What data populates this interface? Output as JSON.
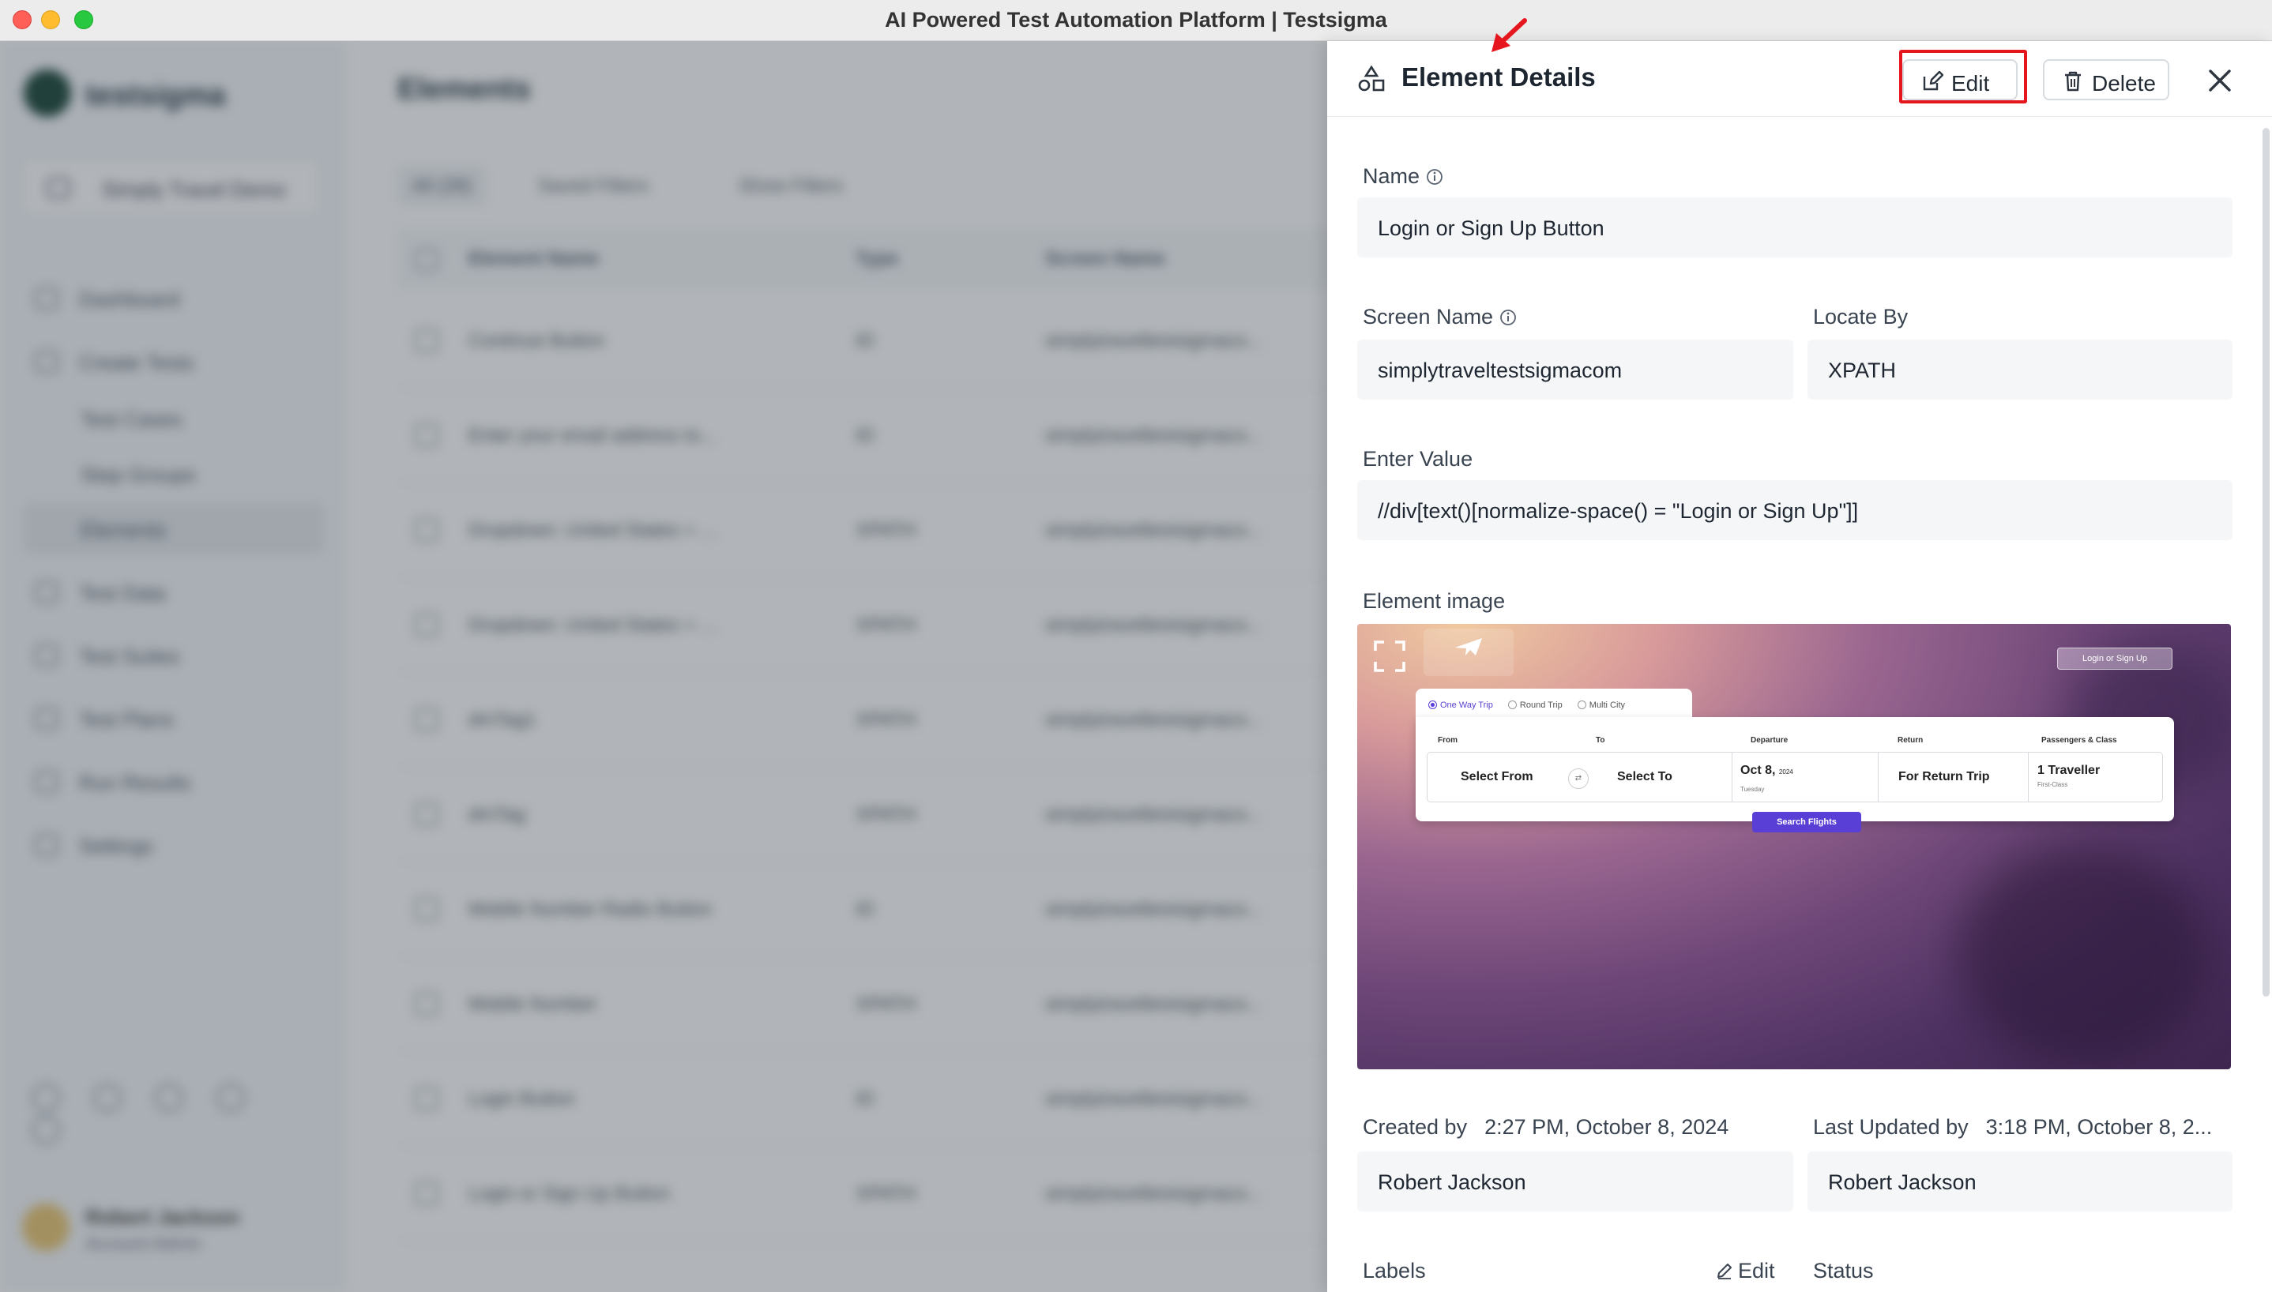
{
  "window": {
    "title": "AI Powered Test Automation Platform | Testsigma"
  },
  "background": {
    "logo": "testsigma",
    "project": "Simply Travel Demo",
    "nav": [
      "Dashboard",
      "Create Tests",
      "Test Cases",
      "Step Groups",
      "Elements",
      "Test Data",
      "Test Suites",
      "Test Plans",
      "Run Results",
      "Settings"
    ],
    "page_title": "Elements",
    "filters": [
      "All (28)",
      "Saved Filters",
      "Show Filters"
    ],
    "columns": [
      "Element Name",
      "Type",
      "Screen Name"
    ],
    "rows": [
      {
        "name": "Continue Button",
        "type": "ID",
        "screen": "simplytraveltestsigmaco..."
      },
      {
        "name": "Enter your email address to...",
        "type": "ID",
        "screen": "simplytraveltestsigmaco..."
      },
      {
        "name": "Dropdown: United States + ...",
        "type": "XPATH",
        "screen": "simplytraveltestsigmaco..."
      },
      {
        "name": "Dropdown: United States + ...",
        "type": "XPATH",
        "screen": "simplytraveltestsigmaco..."
      },
      {
        "name": "dmTag1",
        "type": "XPATH",
        "screen": "simplytraveltestsigmaco..."
      },
      {
        "name": "dmTag",
        "type": "XPATH",
        "screen": "simplytraveltestsigmaco..."
      },
      {
        "name": "Mobile Number Radio Button",
        "type": "ID",
        "screen": "simplytraveltestsigmaco..."
      },
      {
        "name": "Mobile Number",
        "type": "XPATH",
        "screen": "simplytraveltestsigmaco..."
      },
      {
        "name": "Login Button",
        "type": "ID",
        "screen": "simplytraveltestsigmaco..."
      },
      {
        "name": "Login or Sign Up Button",
        "type": "XPATH",
        "screen": "simplytraveltestsigmaco..."
      }
    ],
    "user": {
      "name": "Robert Jackson",
      "role": "Account Admin"
    }
  },
  "panel": {
    "title": "Element Details",
    "edit_label": "Edit",
    "delete_label": "Delete",
    "name_label": "Name",
    "name_value": "Login or Sign Up Button",
    "screen_name_label": "Screen Name",
    "screen_name_value": "simplytraveltestsigmacom",
    "locate_by_label": "Locate By",
    "locate_by_value": "XPATH",
    "enter_value_label": "Enter Value",
    "enter_value_value": "//div[text()[normalize-space() = \"Login or Sign Up\"]]",
    "element_image_label": "Element image",
    "created_by_label": "Created by",
    "created_at": "2:27 PM, October 8, 2024",
    "created_by_value": "Robert Jackson",
    "last_updated_label": "Last Updated by",
    "updated_at": "3:18 PM, October 8, 2...",
    "updated_by_value": "Robert Jackson",
    "labels_label": "Labels",
    "labels_edit": "Edit",
    "status_label": "Status"
  },
  "element_image": {
    "login_button": "Login or Sign Up",
    "trip_types": [
      "One Way Trip",
      "Round Trip",
      "Multi City"
    ],
    "columns": [
      "From",
      "To",
      "Departure",
      "Return",
      "Passengers & Class"
    ],
    "from_value": "Select From",
    "to_value": "Select To",
    "departure_value": "Oct 8,",
    "departure_year": "2024",
    "departure_day": "Tuesday",
    "return_value": "For Return Trip",
    "passengers_value": "1 Traveller",
    "class_value": "First-Class",
    "search_button": "Search Flights"
  },
  "colors": {
    "highlight": "#e5161d",
    "accent": "#5a3fd6"
  }
}
